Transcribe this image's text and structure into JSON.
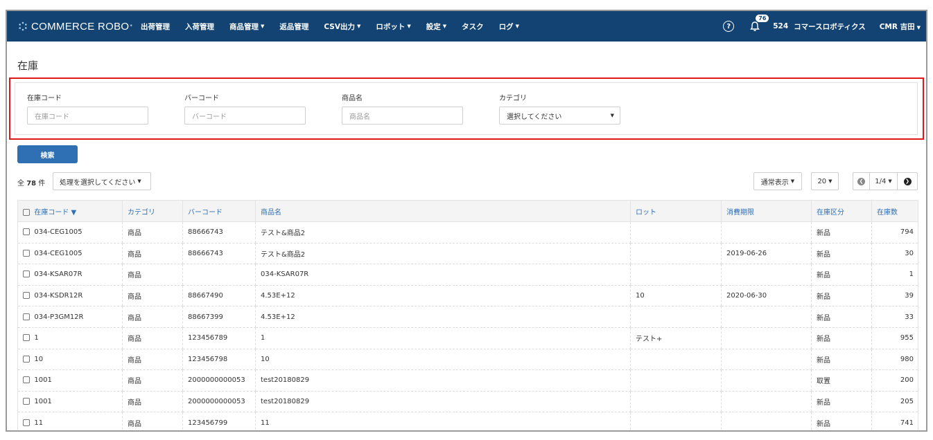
{
  "nav": {
    "brand": "COMMERCE ROBO",
    "brand_mark": "*",
    "items": [
      {
        "label": "出荷管理",
        "caret": false
      },
      {
        "label": "入荷管理",
        "caret": false
      },
      {
        "label": "商品管理",
        "caret": true
      },
      {
        "label": "返品管理",
        "caret": false
      },
      {
        "label": "CSV出力",
        "caret": true
      },
      {
        "label": "ロボット",
        "caret": true
      },
      {
        "label": "設定",
        "caret": true
      },
      {
        "label": "タスク",
        "caret": false
      },
      {
        "label": "ログ",
        "caret": true
      }
    ],
    "help_icon": "?",
    "notification_count": "76",
    "user_id": "524",
    "company": "コマースロボティクス",
    "user_name": "CMR 吉田"
  },
  "page": {
    "title": "在庫"
  },
  "filters": {
    "stock_code": {
      "label": "在庫コード",
      "placeholder": "在庫コード"
    },
    "barcode": {
      "label": "バーコード",
      "placeholder": "バーコード"
    },
    "product_name": {
      "label": "商品名",
      "placeholder": "商品名"
    },
    "category": {
      "label": "カテゴリ",
      "selected": "選択してください"
    }
  },
  "search_button": "検索",
  "toolbar": {
    "count_prefix": "全",
    "count_value": "78",
    "count_suffix": "件",
    "bulk_action": "処理を選択してください",
    "view_mode": "通常表示",
    "per_page": "20",
    "page": "1/4"
  },
  "table": {
    "columns": [
      "在庫コード ▼",
      "カテゴリ",
      "バーコード",
      "商品名",
      "ロット",
      "消費期限",
      "在庫区分",
      "在庫数"
    ],
    "rows": [
      [
        "034-CEG1005",
        "商品",
        "88666743",
        "テスト&商品2",
        "",
        "",
        "新品",
        "794"
      ],
      [
        "034-CEG1005",
        "商品",
        "88666743",
        "テスト&商品2",
        "",
        "2019-06-26",
        "新品",
        "30"
      ],
      [
        "034-KSAR07R",
        "商品",
        "",
        "034-KSAR07R",
        "",
        "",
        "新品",
        "1"
      ],
      [
        "034-KSDR12R",
        "商品",
        "88667490",
        "4.53E+12",
        "10",
        "2020-06-30",
        "新品",
        "39"
      ],
      [
        "034-P3GM12R",
        "商品",
        "88667399",
        "4.53E+12",
        "",
        "",
        "新品",
        "33"
      ],
      [
        "1",
        "商品",
        "123456789",
        "1",
        "テスト+",
        "",
        "新品",
        "955"
      ],
      [
        "10",
        "商品",
        "123456798",
        "10",
        "",
        "",
        "新品",
        "980"
      ],
      [
        "1001",
        "商品",
        "2000000000053",
        "test20180829",
        "",
        "",
        "取置",
        "200"
      ],
      [
        "1001",
        "商品",
        "2000000000053",
        "test20180829",
        "",
        "",
        "新品",
        "205"
      ],
      [
        "11",
        "商品",
        "123456799",
        "11",
        "",
        "",
        "新品",
        "741"
      ]
    ]
  }
}
